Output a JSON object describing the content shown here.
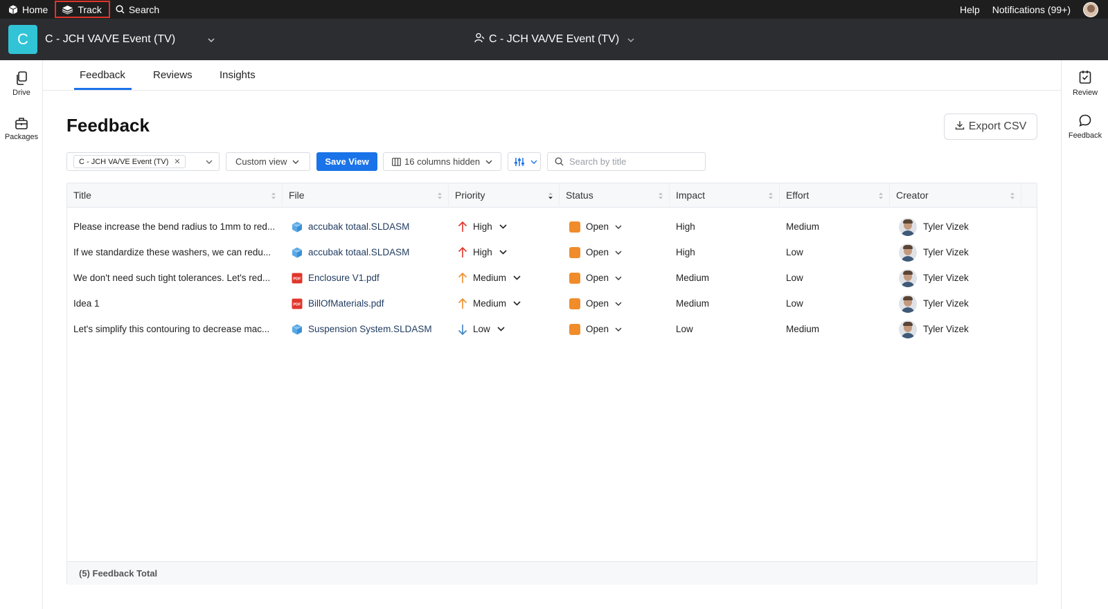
{
  "topbar": {
    "home_label": "Home",
    "track_label": "Track",
    "search_label": "Search",
    "help_label": "Help",
    "notifications_label": "Notifications (99+)"
  },
  "header": {
    "project_initial": "C",
    "project_name": "C - JCH VA/VE Event (TV)",
    "center_title": "C - JCH VA/VE Event (TV)"
  },
  "left_rail": [
    {
      "label": "Drive",
      "icon": "drive-icon"
    },
    {
      "label": "Packages",
      "icon": "packages-icon"
    }
  ],
  "right_rail": [
    {
      "label": "Review",
      "icon": "review-icon"
    },
    {
      "label": "Feedback",
      "icon": "feedback-icon"
    }
  ],
  "tabs": [
    {
      "label": "Feedback",
      "active": true
    },
    {
      "label": "Reviews",
      "active": false
    },
    {
      "label": "Insights",
      "active": false
    }
  ],
  "page": {
    "title": "Feedback",
    "export_label": "Export CSV"
  },
  "toolbar": {
    "filter_chip": "C - JCH VA/VE Event (TV)",
    "view_select": "Custom view",
    "save_view_label": "Save View",
    "columns_hidden_label": "16 columns hidden",
    "search_placeholder": "Search by title"
  },
  "table": {
    "columns": [
      "Title",
      "File",
      "Priority",
      "Status",
      "Impact",
      "Effort",
      "Creator"
    ],
    "rows": [
      {
        "title": "Please increase the bend radius to 1mm to red...",
        "file": "accubak totaal.SLDASM",
        "file_type": "sldasm",
        "priority": "High",
        "priority_dir": "up",
        "priority_color": "#e0352b",
        "status": "Open",
        "impact": "High",
        "effort": "Medium",
        "creator": "Tyler Vizek"
      },
      {
        "title": "If we standardize these washers, we can redu...",
        "file": "accubak totaal.SLDASM",
        "file_type": "sldasm",
        "priority": "High",
        "priority_dir": "up",
        "priority_color": "#e0352b",
        "status": "Open",
        "impact": "High",
        "effort": "Low",
        "creator": "Tyler Vizek"
      },
      {
        "title": "We don't need such tight tolerances. Let's red...",
        "file": "Enclosure V1.pdf",
        "file_type": "pdf",
        "priority": "Medium",
        "priority_dir": "up",
        "priority_color": "#f08c2a",
        "status": "Open",
        "impact": "Medium",
        "effort": "Low",
        "creator": "Tyler Vizek"
      },
      {
        "title": "Idea 1",
        "file": "BillOfMaterials.pdf",
        "file_type": "pdf",
        "priority": "Medium",
        "priority_dir": "up",
        "priority_color": "#f08c2a",
        "status": "Open",
        "impact": "Medium",
        "effort": "Low",
        "creator": "Tyler Vizek"
      },
      {
        "title": "Let's simplify this contouring to decrease mac...",
        "file": "Suspension System.SLDASM",
        "file_type": "sldasm",
        "priority": "Low",
        "priority_dir": "down",
        "priority_color": "#3b82c4",
        "status": "Open",
        "impact": "Low",
        "effort": "Medium",
        "creator": "Tyler Vizek"
      }
    ],
    "footer_label": "(5) Feedback Total"
  },
  "colors": {
    "accent": "#1a73e8",
    "status_open": "#f08c2a",
    "project_tile": "#31c4d6"
  }
}
